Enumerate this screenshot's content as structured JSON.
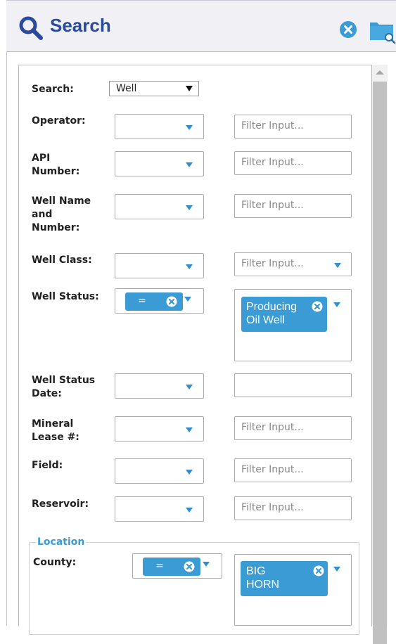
{
  "header": {
    "title": "Search",
    "icons": [
      "search-icon",
      "clear-icon",
      "folder-search-icon"
    ]
  },
  "search_type": {
    "label": "Search:",
    "value": "Well"
  },
  "fields": {
    "operator": {
      "label": "Operator:",
      "placeholder": "Filter Input..."
    },
    "api": {
      "label_lines": [
        "API",
        "Number:"
      ],
      "placeholder": "Filter Input..."
    },
    "well_name": {
      "label_lines": [
        "Well Name",
        "and",
        "Number:"
      ],
      "placeholder": "Filter Input..."
    },
    "well_class": {
      "label": "Well Class:",
      "placeholder": "Filter Input..."
    },
    "well_status": {
      "label": "Well Status:",
      "operator": "=",
      "tag_lines": [
        "Producing",
        "Oil Well"
      ]
    },
    "well_status_date": {
      "label_lines": [
        "Well Status",
        "Date:"
      ],
      "value": ""
    },
    "mineral_lease": {
      "label_lines": [
        "Mineral",
        "Lease #:"
      ],
      "placeholder": "Filter Input..."
    },
    "field": {
      "label": "Field:",
      "placeholder": "Filter Input..."
    },
    "reservoir": {
      "label": "Reservoir:",
      "placeholder": "Filter Input..."
    }
  },
  "location": {
    "legend": "Location",
    "county": {
      "label": "County:",
      "operator": "=",
      "tag_lines": [
        "BIG",
        "HORN"
      ]
    }
  },
  "colors": {
    "accent": "#3a9bd5",
    "title": "#2a4a9b",
    "header_bg": "#f1f1f5"
  }
}
